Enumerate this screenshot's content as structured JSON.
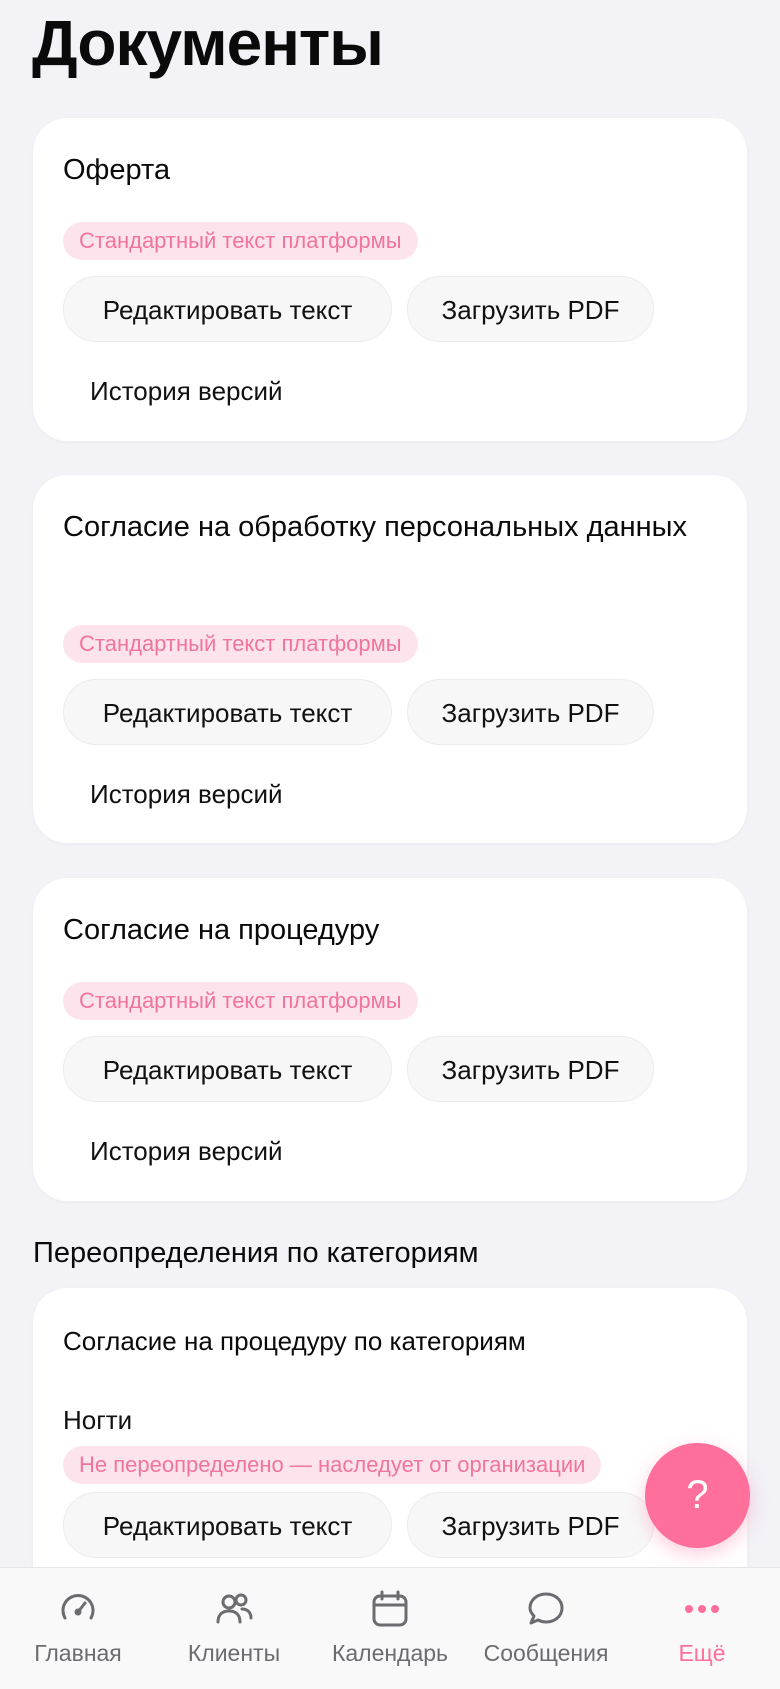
{
  "page": {
    "title": "Документы"
  },
  "documents": [
    {
      "title": "Оферта",
      "badge": "Стандартный текст платформы",
      "edit_label": "Редактировать текст",
      "upload_label": "Загрузить PDF",
      "history_label": "История версий"
    },
    {
      "title": "Согласие на обработку персональных данных",
      "badge": "Стандартный текст платформы",
      "edit_label": "Редактировать текст",
      "upload_label": "Загрузить PDF",
      "history_label": "История версий"
    },
    {
      "title": "Согласие на процедуру",
      "badge": "Стандартный текст платформы",
      "edit_label": "Редактировать текст",
      "upload_label": "Загрузить PDF",
      "history_label": "История версий"
    }
  ],
  "overrides": {
    "section_title": "Переопределения по категориям",
    "card_title": "Согласие на процедуру по категориям",
    "category": "Ногти",
    "badge": "Не переопределено — наследует от организации",
    "edit_label": "Редактировать текст",
    "upload_label": "Загрузить PDF"
  },
  "fab": {
    "label": "?"
  },
  "tabbar": {
    "items": [
      {
        "label": "Главная",
        "icon": "gauge-icon"
      },
      {
        "label": "Клиенты",
        "icon": "users-icon"
      },
      {
        "label": "Календарь",
        "icon": "calendar-icon"
      },
      {
        "label": "Сообщения",
        "icon": "chat-bubble-icon"
      },
      {
        "label": "Ещё",
        "icon": "more-dots-icon",
        "active": true
      }
    ]
  },
  "colors": {
    "accent": "#ff6f9b",
    "badge_bg": "#fde4ec",
    "badge_text": "#f0749c",
    "background": "#f2f2f7"
  }
}
